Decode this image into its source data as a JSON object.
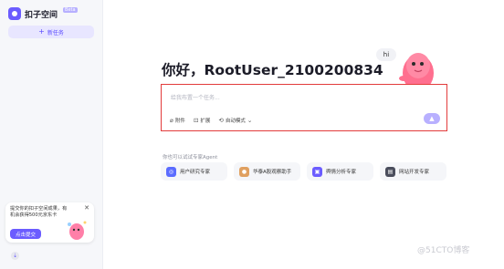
{
  "sidebar": {
    "brand_name": "扣子空间",
    "beta_badge": "Beta",
    "new_task_label": "新任务",
    "promo": {
      "text": "提交你的扣子空间成果，有机会获得500元京东卡",
      "button_label": "点击提交"
    }
  },
  "main": {
    "greeting": "你好，RootUser_2100200834",
    "hi_bubble": "hi",
    "input": {
      "placeholder": "给我布置一个任务...",
      "tools": [
        {
          "label": "附件",
          "icon": "paperclip-icon"
        },
        {
          "label": "扩展",
          "icon": "extension-icon"
        },
        {
          "label": "自动模式",
          "icon": "auto-mode-icon"
        }
      ],
      "send_icon": "send-arrow-icon"
    },
    "agent_hint": "你也可以试试专家Agent",
    "agents": [
      {
        "label": "用户研究专家",
        "icon": "user-research-icon",
        "color": "#5b6cff"
      },
      {
        "label": "华泰A股观察助手",
        "icon": "stock-observer-icon",
        "color": "#e0a060"
      },
      {
        "label": "舆情分析专家",
        "icon": "opinion-analysis-icon",
        "color": "#6b5cff"
      },
      {
        "label": "网站开发专家",
        "icon": "web-dev-icon",
        "color": "#4a4d5c"
      }
    ]
  },
  "watermark": "@51CTO博客",
  "colors": {
    "accent": "#6b5cff",
    "highlight_border": "#e23b3b"
  }
}
